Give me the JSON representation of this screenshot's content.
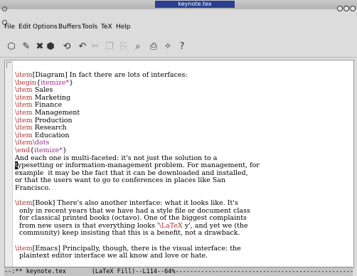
{
  "window": {
    "title": "keynote.tex"
  },
  "menu": [
    "File",
    "Edit",
    "Options",
    "Buffers",
    "Tools",
    "TeX",
    "Help"
  ],
  "toolbar": [
    {
      "icon": "open-folder-icon",
      "glyph": "⬡"
    },
    {
      "icon": "open-file-icon",
      "glyph": "✎"
    },
    {
      "icon": "close-icon",
      "glyph": "✖"
    },
    {
      "icon": "save-icon",
      "glyph": "⬢"
    },
    {
      "icon": "save-as-icon",
      "glyph": "⟲"
    },
    {
      "icon": "undo-icon",
      "glyph": "↶"
    },
    {
      "icon": "cut-icon",
      "glyph": "✂"
    },
    {
      "icon": "copy-icon",
      "glyph": "❐"
    },
    {
      "icon": "paste-icon",
      "glyph": "⎘"
    },
    {
      "icon": "search-icon",
      "glyph": "⌕"
    },
    {
      "icon": "print-icon",
      "glyph": "⎙"
    },
    {
      "icon": "tools-icon",
      "glyph": "✧"
    },
    {
      "icon": "help-icon",
      "glyph": "?"
    }
  ],
  "editor": {
    "lines": [
      [
        {
          "t": "\\item",
          "c": "kw"
        },
        {
          "t": "[Diagram] In fact there are lots of interfaces:"
        }
      ],
      [
        {
          "t": "\\begin",
          "c": "kw"
        },
        {
          "t": "{"
        },
        {
          "t": "itemize*",
          "c": "kw2"
        },
        {
          "t": "}"
        }
      ],
      [
        {
          "t": "\\item",
          "c": "kw"
        },
        {
          "t": " Sales"
        }
      ],
      [
        {
          "t": "\\item",
          "c": "kw"
        },
        {
          "t": " Marketing"
        }
      ],
      [
        {
          "t": "\\item",
          "c": "kw"
        },
        {
          "t": " Finance"
        }
      ],
      [
        {
          "t": "\\item",
          "c": "kw"
        },
        {
          "t": " Management"
        }
      ],
      [
        {
          "t": "\\item",
          "c": "kw"
        },
        {
          "t": " Production"
        }
      ],
      [
        {
          "t": "\\item",
          "c": "kw"
        },
        {
          "t": " Research"
        }
      ],
      [
        {
          "t": "\\item",
          "c": "kw"
        },
        {
          "t": " Education"
        }
      ],
      [
        {
          "t": "\\item",
          "c": "kw"
        },
        {
          "t": "\\dots",
          "c": "kw2"
        }
      ],
      [
        {
          "t": "\\end",
          "c": "kw"
        },
        {
          "t": "{"
        },
        {
          "t": "itemize*",
          "c": "kw2"
        },
        {
          "t": "}"
        }
      ],
      [
        {
          "t": "And each one is multi-faceted: it's not just the solution to a"
        }
      ],
      [
        {
          "t": "t",
          "c": "cursor"
        },
        {
          "t": "ypesetting or information-management problem. For management, for"
        }
      ],
      [
        {
          "t": "example  it may be the fact that it can be downloaded and installed,"
        }
      ],
      [
        {
          "t": "or that the users want to go to conferences in places like San"
        }
      ],
      [
        {
          "t": "Francisco."
        }
      ],
      [
        {
          "t": ""
        }
      ],
      [
        {
          "t": "\\item",
          "c": "kw"
        },
        {
          "t": "[Book] There's also another interface: what it looks like. It's"
        }
      ],
      [
        {
          "t": "  only in recent years that we have had a style file or document class"
        }
      ],
      [
        {
          "t": "  for classical printed books (octavo). One of the biggest complaints"
        }
      ],
      [
        {
          "t": "  from new users is that everything looks '"
        },
        {
          "t": "\\LaTeX",
          "c": "kw"
        },
        {
          "t": " y', and yet we (the"
        }
      ],
      [
        {
          "t": "  community) keep insisting that this is a benefit, not a drawback."
        }
      ],
      [
        {
          "t": ""
        }
      ],
      [
        {
          "t": "\\item",
          "c": "kw"
        },
        {
          "t": "[Emacs] Principally, though, there is the visual interface: the"
        }
      ],
      [
        {
          "t": "  plaintext editor interface we all know and love or hate."
        }
      ]
    ]
  },
  "modeline": {
    "text": "--:** keynote.tex       (LaTeX Fill)--L114--64%-----------------------------------------------------"
  }
}
